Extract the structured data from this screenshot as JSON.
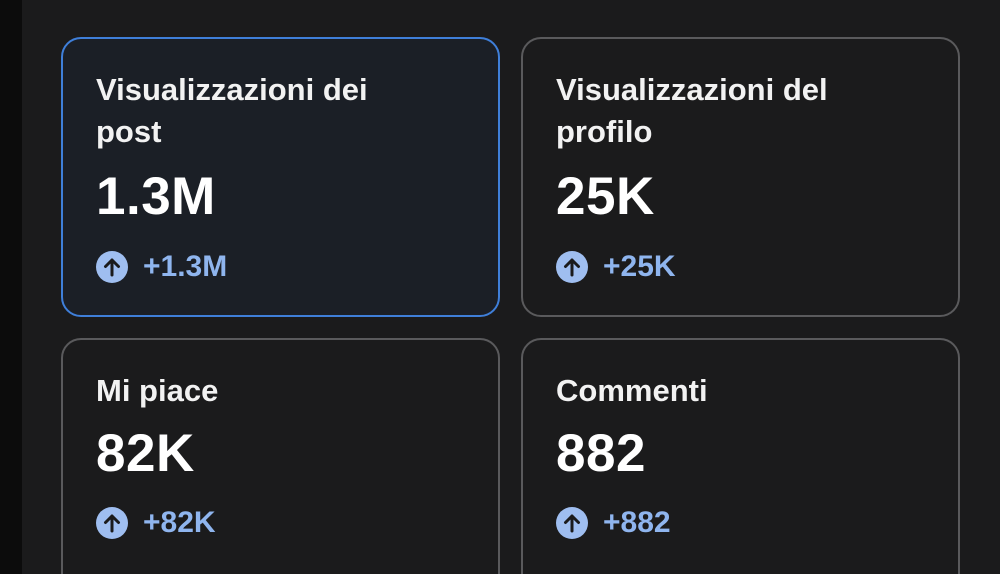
{
  "cards": [
    {
      "label": "Visualizzazioni dei post",
      "value": "1.3M",
      "delta": "+1.3M",
      "selected": true
    },
    {
      "label": "Visualizzazioni del profilo",
      "value": "25K",
      "delta": "+25K",
      "selected": false
    },
    {
      "label": "Mi piace",
      "value": "82K",
      "delta": "+82K",
      "selected": false
    },
    {
      "label": "Commenti",
      "value": "882",
      "delta": "+882",
      "selected": false
    }
  ],
  "colors": {
    "background": "#1b1b1c",
    "card_border": "#5a5a5c",
    "selected_border": "#3f7fd9",
    "delta_text": "#8fb5ee",
    "up_icon_fill": "#9fbef0"
  },
  "icons": {
    "trend": "arrow-up-circle-icon"
  }
}
